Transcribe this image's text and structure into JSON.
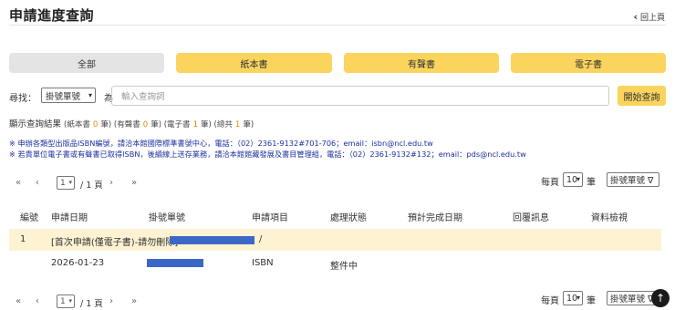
{
  "header": {
    "title": "申請進度查詢",
    "back_label": "回上頁"
  },
  "tabs": [
    {
      "label": "全部"
    },
    {
      "label": "紙本書"
    },
    {
      "label": "有聲書"
    },
    {
      "label": "電子書"
    }
  ],
  "search": {
    "label": "尋找：",
    "field_value": "掛號單號",
    "connector": "為",
    "placeholder": "輸入查詢詞",
    "button_label": "開始查詢"
  },
  "summary": {
    "prefix": "顯示查詢結果",
    "paper_label": "(紙本書",
    "paper_count": "0",
    "audio_label": "筆) (有聲書",
    "audio_count": "0",
    "ebook_label": "筆) (電子書",
    "ebook_count": "1",
    "total_label": "筆) (總共",
    "total_count": "1",
    "suffix": "筆)"
  },
  "notes": [
    "※ 申辦各類型出版品ISBN編號，請洽本館國際標準書號中心，電話：（02）2361-9132#701-706；email：isbn@ncl.edu.tw",
    "※ 若貴單位電子書或有聲書已取得ISBN，後續線上送存業務，請洽本館館藏發展及書目管理組，電話：（02）2361-9132#132；email：pds@ncl.edu.tw"
  ],
  "pager": {
    "first": "«",
    "prev": "‹",
    "page": "1",
    "total": "/ 1 頁",
    "next": "›",
    "last": "»",
    "per_page_label": "每頁",
    "per_page_value": "10",
    "per_page_unit": "筆",
    "sort_value": "掛號單號 ∇"
  },
  "table": {
    "headers": [
      "編號",
      "申請日期",
      "掛號單號",
      "申請項目",
      "處理狀態",
      "預計完成日期",
      "回覆訊息",
      "資料檢視"
    ],
    "group_row": {
      "number": "1",
      "title": "[首次申請(僅電子書)-請勿刪除]",
      "slash": "/"
    },
    "detail_row": {
      "date": "2026-01-23",
      "item": "ISBN",
      "status": "整件中"
    }
  },
  "colors": {
    "accent": "#fbd45d",
    "row_highlight": "#fdf2d2",
    "note_text": "#1c2fa0",
    "count_text": "#e08a00",
    "redaction": "#3b68c7"
  },
  "scroll_top": {
    "icon": "arrow-up-icon",
    "glyph": "↑"
  }
}
